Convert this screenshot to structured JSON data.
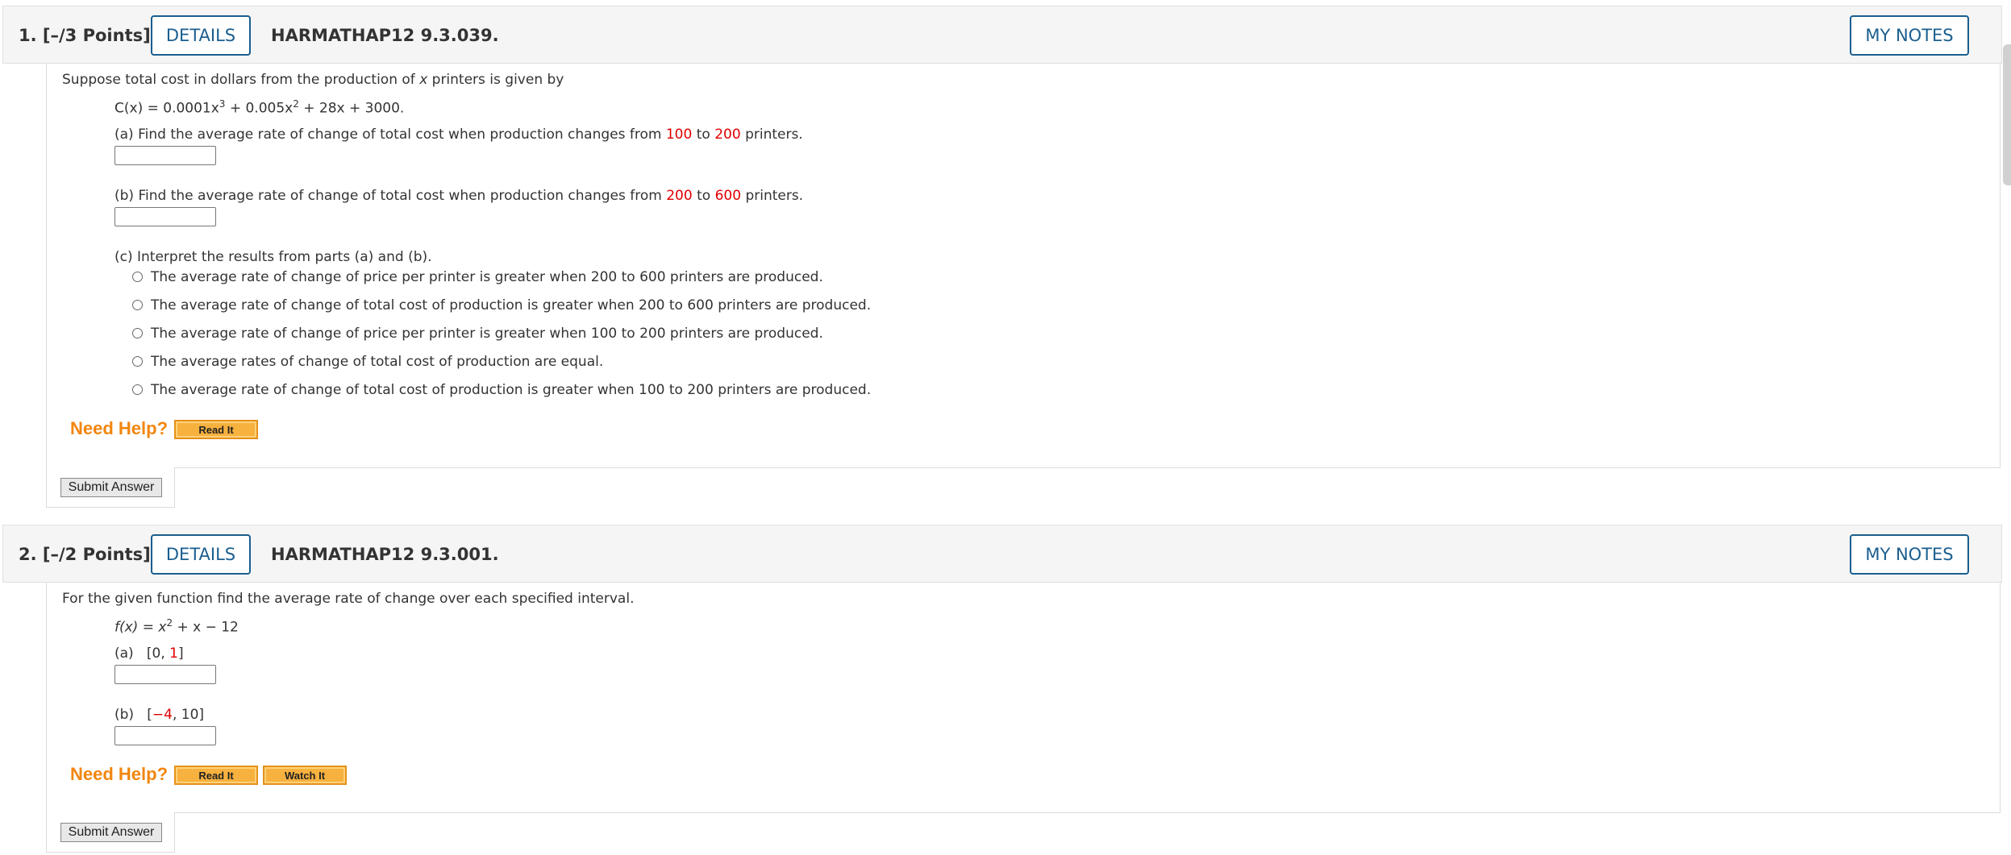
{
  "q1": {
    "number": "1.",
    "points": "[–/3 Points]",
    "details_label": "DETAILS",
    "code": "HARMATHAP12 9.3.039.",
    "notes_label": "MY NOTES",
    "intro_pre": "Suppose total cost in dollars from the production of",
    "intro_var": "x",
    "intro_post": "printers is given by",
    "formula": {
      "lhs": "C(x) = 0.0001x",
      "exp1": "3",
      "mid": " + 0.005x",
      "exp2": "2",
      "rhs": " + 28x + 3000."
    },
    "part_a": {
      "pre": "(a) Find the average rate of change of total cost when production changes from",
      "v1": "100",
      "to": "to",
      "v2": "200",
      "post": "printers."
    },
    "part_b": {
      "pre": "(b) Find the average rate of change of total cost when production changes from",
      "v1": "200",
      "to": "to",
      "v2": "600",
      "post": "printers."
    },
    "part_c": "(c) Interpret the results from parts (a) and (b).",
    "options": [
      "The average rate of change of price per printer is greater when 200 to 600 printers are produced.",
      "The average rate of change of total cost of production is greater when 200 to 600 printers are produced.",
      "The average rate of change of price per printer is greater when 100 to 200 printers are produced.",
      "The average rates of change of total cost of production are equal.",
      "The average rate of change of total cost of production is greater when 100 to 200 printers are produced."
    ],
    "need_help": "Need Help?",
    "read_it": "Read It",
    "submit": "Submit Answer"
  },
  "q2": {
    "number": "2.",
    "points": "[–/2 Points]",
    "details_label": "DETAILS",
    "code": "HARMATHAP12 9.3.001.",
    "notes_label": "MY NOTES",
    "intro": "For the given function find the average rate of change over each specified interval.",
    "formula": {
      "lhs": "f(x) = x",
      "exp": "2",
      "rhs": " + x − 12"
    },
    "part_a": {
      "label": "(a)",
      "open": "[0, ",
      "v": "1",
      "close": "]"
    },
    "part_b": {
      "label": "(b)",
      "open": "[",
      "v": "−4",
      "close": ", 10]"
    },
    "need_help": "Need Help?",
    "read_it": "Read It",
    "watch_it": "Watch It",
    "submit": "Submit Answer"
  }
}
